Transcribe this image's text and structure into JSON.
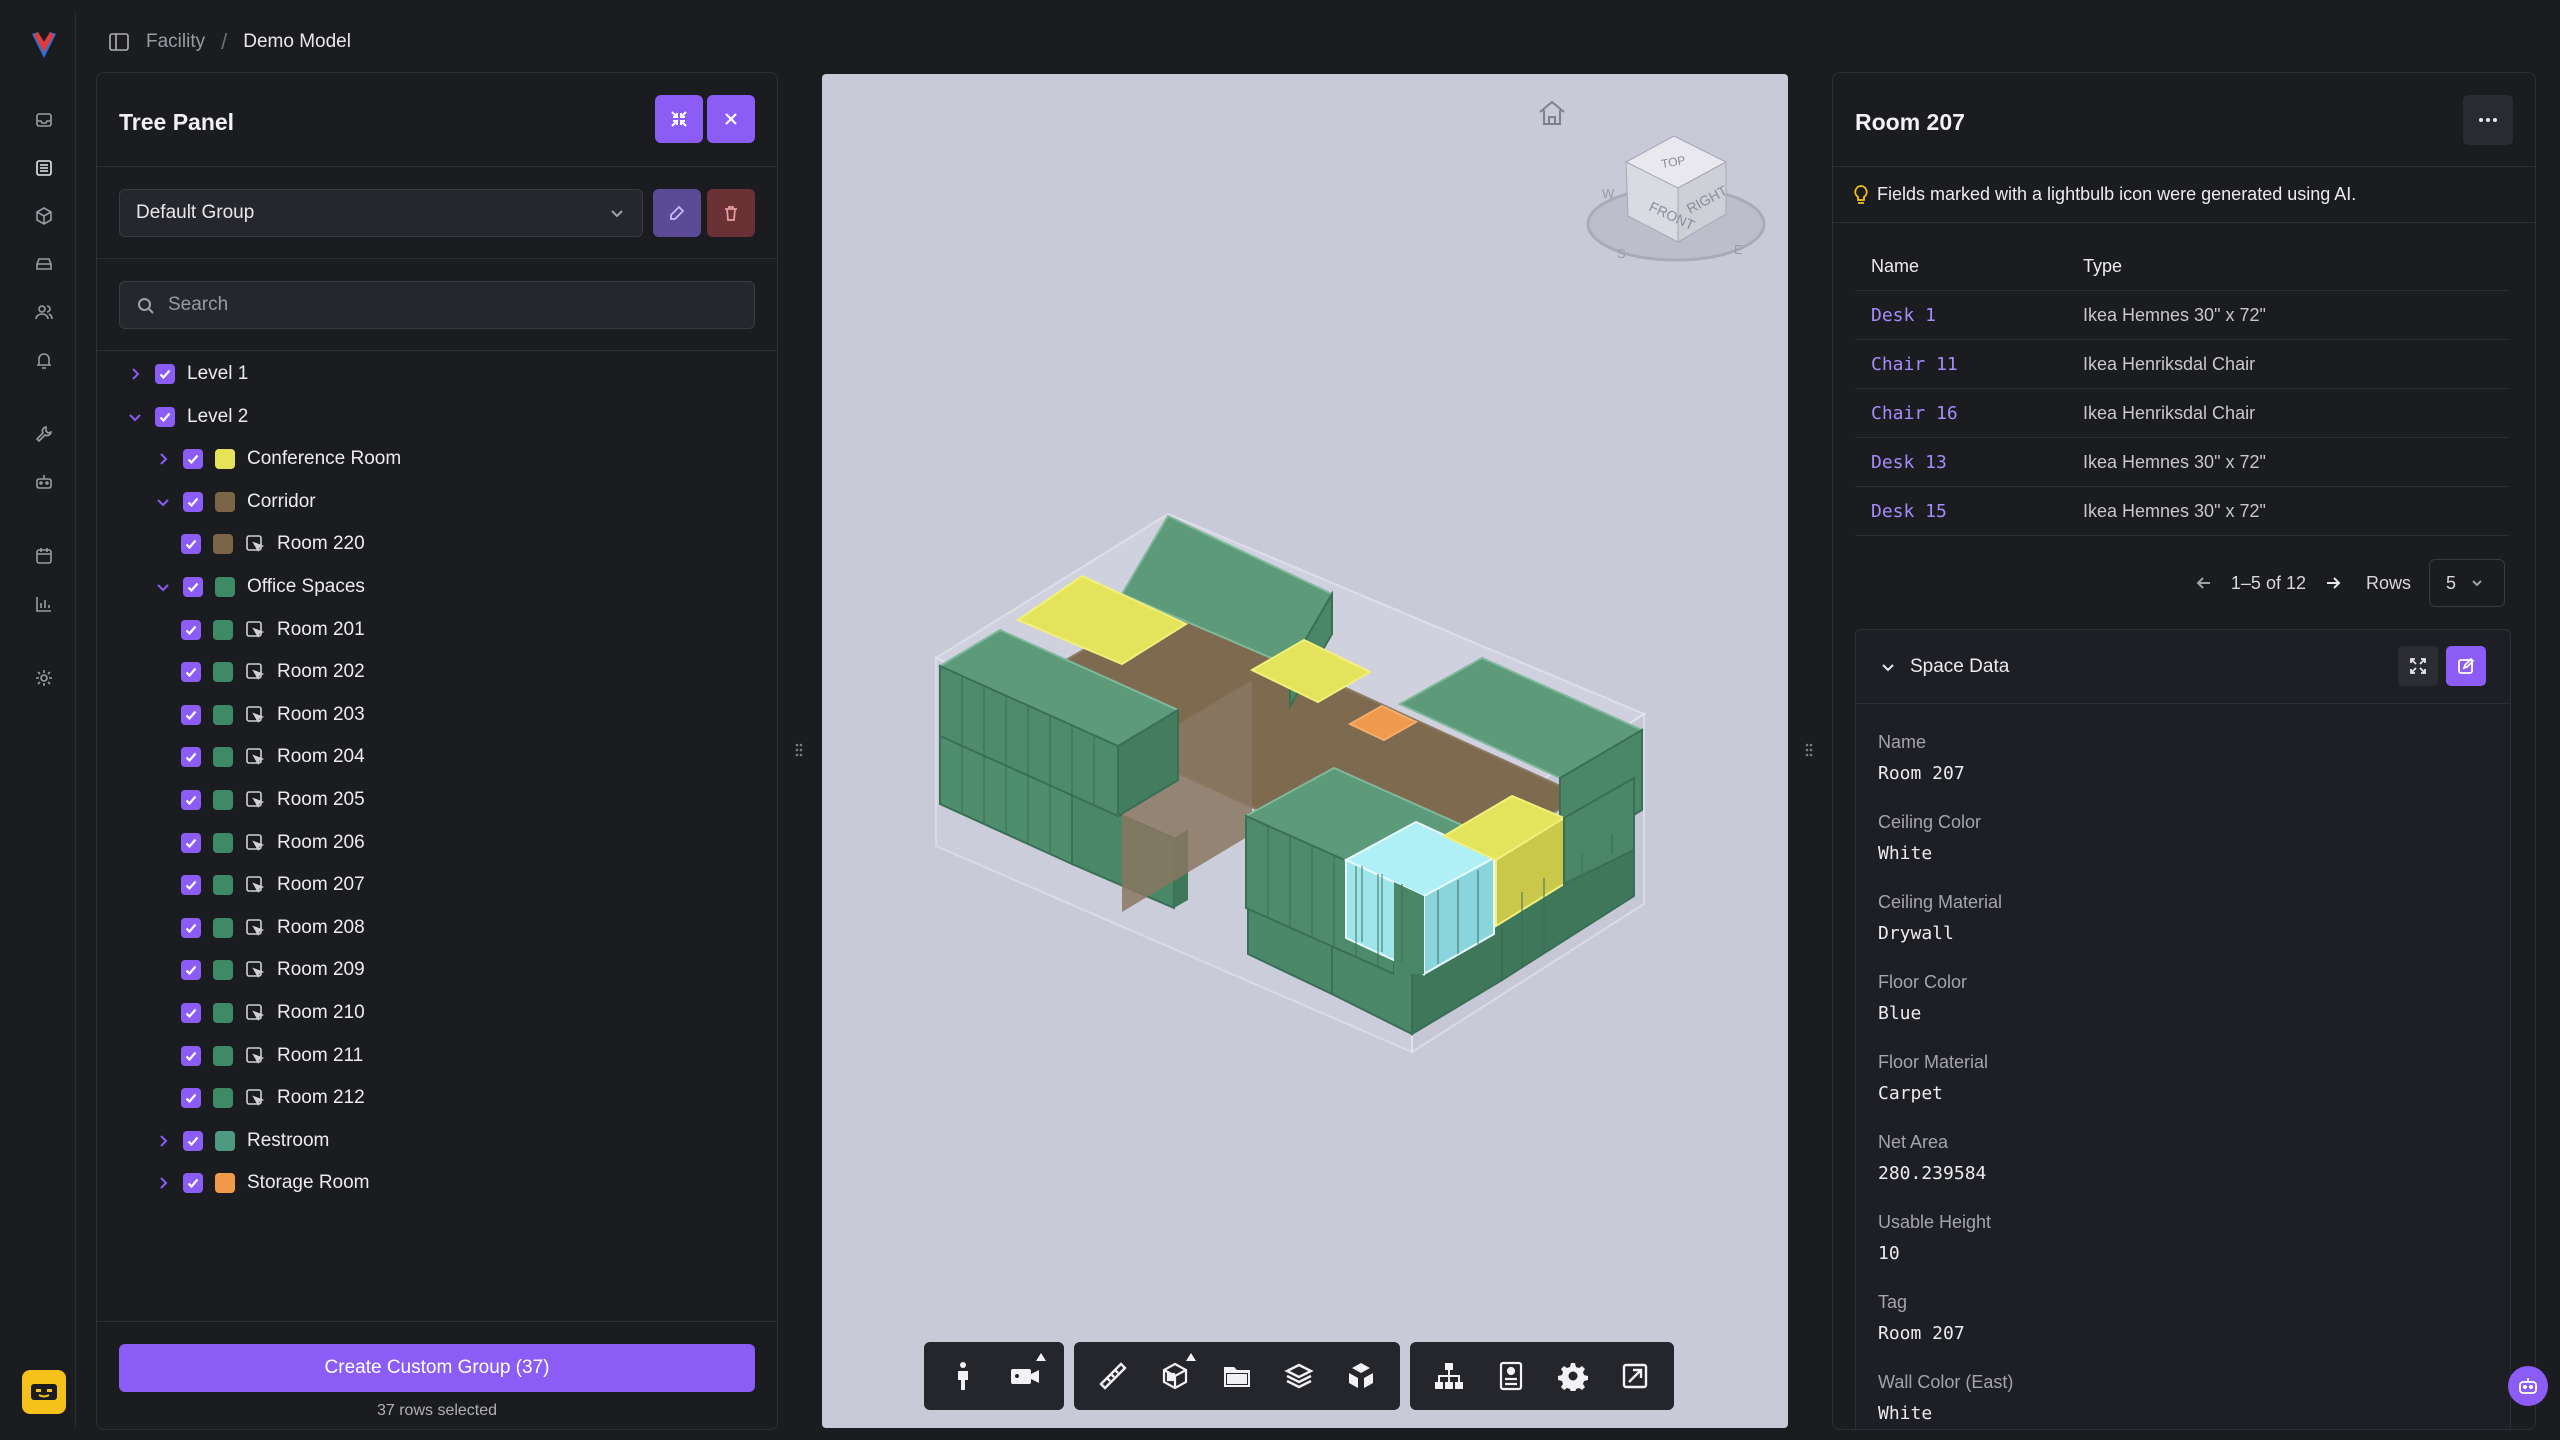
{
  "breadcrumb": {
    "item1": "Facility",
    "item2": "Demo Model"
  },
  "rail": {
    "icons": [
      "inbox-icon",
      "building-icon",
      "cube-icon",
      "tray-icon",
      "users-icon",
      "bell-icon",
      "tool-icon",
      "robot-icon",
      "calendar-icon",
      "chart-icon",
      "gear-icon"
    ]
  },
  "tree_panel": {
    "title": "Tree Panel",
    "group_select": "Default Group",
    "search_placeholder": "Search",
    "create_button": "Create Custom Group (37)",
    "rows_selected": "37 rows selected",
    "items": [
      {
        "label": "Level 1",
        "chevron": "right",
        "swatch": "",
        "room": false
      },
      {
        "label": "Level 2",
        "chevron": "down",
        "swatch": "",
        "room": false
      },
      {
        "label": "Conference Room",
        "chevron": "right",
        "swatch": "#e6e35b",
        "room": false
      },
      {
        "label": "Corridor",
        "chevron": "down",
        "swatch": "#7a6547",
        "room": false
      },
      {
        "label": "Room 220",
        "chevron": "",
        "swatch": "#7a6547",
        "room": true
      },
      {
        "label": "Office Spaces",
        "chevron": "down",
        "swatch": "#3e8a66",
        "room": false
      },
      {
        "label": "Room 201",
        "chevron": "",
        "swatch": "#3e8a66",
        "room": true
      },
      {
        "label": "Room 202",
        "chevron": "",
        "swatch": "#3e8a66",
        "room": true
      },
      {
        "label": "Room 203",
        "chevron": "",
        "swatch": "#3e8a66",
        "room": true
      },
      {
        "label": "Room 204",
        "chevron": "",
        "swatch": "#3e8a66",
        "room": true
      },
      {
        "label": "Room 205",
        "chevron": "",
        "swatch": "#3e8a66",
        "room": true
      },
      {
        "label": "Room 206",
        "chevron": "",
        "swatch": "#3e8a66",
        "room": true
      },
      {
        "label": "Room 207",
        "chevron": "",
        "swatch": "#3e8a66",
        "room": true
      },
      {
        "label": "Room 208",
        "chevron": "",
        "swatch": "#3e8a66",
        "room": true
      },
      {
        "label": "Room 209",
        "chevron": "",
        "swatch": "#3e8a66",
        "room": true
      },
      {
        "label": "Room 210",
        "chevron": "",
        "swatch": "#3e8a66",
        "room": true
      },
      {
        "label": "Room 211",
        "chevron": "",
        "swatch": "#3e8a66",
        "room": true
      },
      {
        "label": "Room 212",
        "chevron": "",
        "swatch": "#3e8a66",
        "room": true
      },
      {
        "label": "Restroom",
        "chevron": "right",
        "swatch": "#4d9a80",
        "room": false
      },
      {
        "label": "Storage Room",
        "chevron": "right",
        "swatch": "#f09a4a",
        "room": false
      }
    ]
  },
  "viewer": {
    "viewcube_labels": {
      "top": "TOP",
      "front": "FRONT",
      "right": "RIGHT",
      "w": "W",
      "s": "S",
      "e": "E"
    },
    "toolbar": [
      [
        "walk-icon",
        "camera-icon"
      ],
      [
        "ruler-icon",
        "section-box-icon",
        "folder-icon",
        "layers-icon",
        "explode-icon"
      ],
      [
        "hierarchy-icon",
        "properties-icon",
        "settings-icon",
        "fullscreen-icon"
      ]
    ]
  },
  "props": {
    "title": "Room 207",
    "ai_note": "Fields marked with a lightbulb icon were generated using AI.",
    "table_headers": {
      "name": "Name",
      "type": "Type"
    },
    "rows": [
      {
        "name": "Desk 1",
        "type": "Ikea Hemnes 30\" x 72\""
      },
      {
        "name": "Chair 11",
        "type": "Ikea Henriksdal Chair"
      },
      {
        "name": "Chair 16",
        "type": "Ikea Henriksdal Chair"
      },
      {
        "name": "Desk 13",
        "type": "Ikea Hemnes 30\" x 72\""
      },
      {
        "name": "Desk 15",
        "type": "Ikea Hemnes 30\" x 72\""
      }
    ],
    "pager": {
      "range": "1–5 of 12",
      "rows_label": "Rows",
      "rows_value": "5"
    },
    "space_data": {
      "title": "Space Data",
      "fields": [
        {
          "label": "Name",
          "value": "Room 207"
        },
        {
          "label": "Ceiling Color",
          "value": "White"
        },
        {
          "label": "Ceiling Material",
          "value": "Drywall"
        },
        {
          "label": "Floor Color",
          "value": "Blue"
        },
        {
          "label": "Floor Material",
          "value": "Carpet"
        },
        {
          "label": "Net Area",
          "value": "280.239584"
        },
        {
          "label": "Usable Height",
          "value": "10"
        },
        {
          "label": "Tag",
          "value": "Room 207"
        },
        {
          "label": "Wall Color (East)",
          "value": "White"
        }
      ]
    }
  },
  "colors": {
    "accent": "#8b5cf6",
    "danger": "#7a3236",
    "link": "#a78bfa"
  }
}
